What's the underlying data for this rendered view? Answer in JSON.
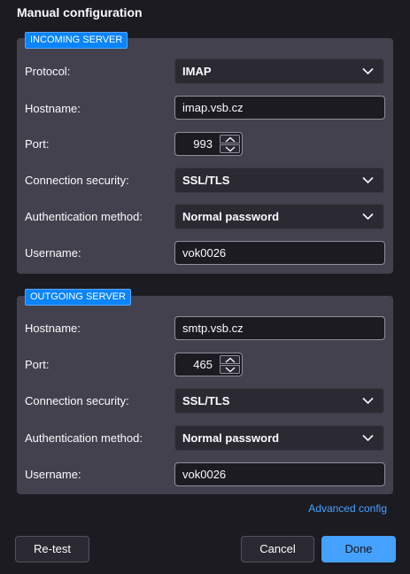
{
  "title": "Manual configuration",
  "incoming": {
    "legend": "INCOMING SERVER",
    "protocol_label": "Protocol:",
    "protocol_value": "IMAP",
    "hostname_label": "Hostname:",
    "hostname_value": "imap.vsb.cz",
    "port_label": "Port:",
    "port_value": "993",
    "security_label": "Connection security:",
    "security_value": "SSL/TLS",
    "auth_label": "Authentication method:",
    "auth_value": "Normal password",
    "username_label": "Username:",
    "username_value": "vok0026"
  },
  "outgoing": {
    "legend": "OUTGOING SERVER",
    "hostname_label": "Hostname:",
    "hostname_value": "smtp.vsb.cz",
    "port_label": "Port:",
    "port_value": "465",
    "security_label": "Connection security:",
    "security_value": "SSL/TLS",
    "auth_label": "Authentication method:",
    "auth_value": "Normal password",
    "username_label": "Username:",
    "username_value": "vok0026"
  },
  "advanced_link": "Advanced config",
  "buttons": {
    "retest": "Re-test",
    "cancel": "Cancel",
    "done": "Done"
  },
  "colors": {
    "background": "#1c1b22",
    "section": "#42414d",
    "accent": "#45a1ff",
    "legend": "#0a84ff"
  },
  "icons": {
    "dropdown": "chevron-down-icon",
    "increment": "chevron-up-icon",
    "decrement": "chevron-down-icon"
  }
}
